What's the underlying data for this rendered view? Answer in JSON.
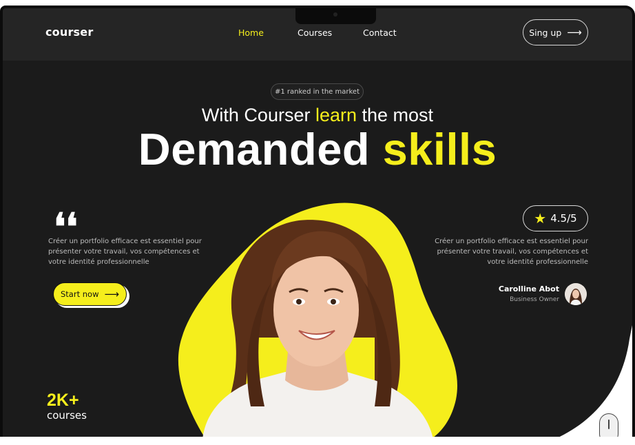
{
  "nav": {
    "logo": "courser",
    "links": [
      "Home",
      "Courses",
      "Contact"
    ],
    "signup": "Sing up",
    "arrow": "⟶"
  },
  "hero": {
    "badge": "#1 ranked in the market",
    "headline_part1": "With Courser ",
    "headline_highlight1": "learn",
    "headline_part2": " the most",
    "headline2_part1": "Demanded ",
    "headline2_highlight": "skills",
    "quote_mark": "❛❛",
    "left_text": "Créer un portfolio efficace est essentiel pour présenter votre travail, vos compétences et votre identité professionnelle",
    "right_text": "Créer un portfolio efficace est essentiel pour présenter votre travail, vos compétences et votre identité professionnelle",
    "start_button": "Start now",
    "rating": "4.5/5",
    "star": "★",
    "reviewer_name": "Carolline Abot",
    "reviewer_role": "Business Owner",
    "count": "2K+",
    "count_label": "courses"
  },
  "colors": {
    "accent": "#f5ee1c",
    "background": "#1b1b1b",
    "navbar": "#252525"
  }
}
